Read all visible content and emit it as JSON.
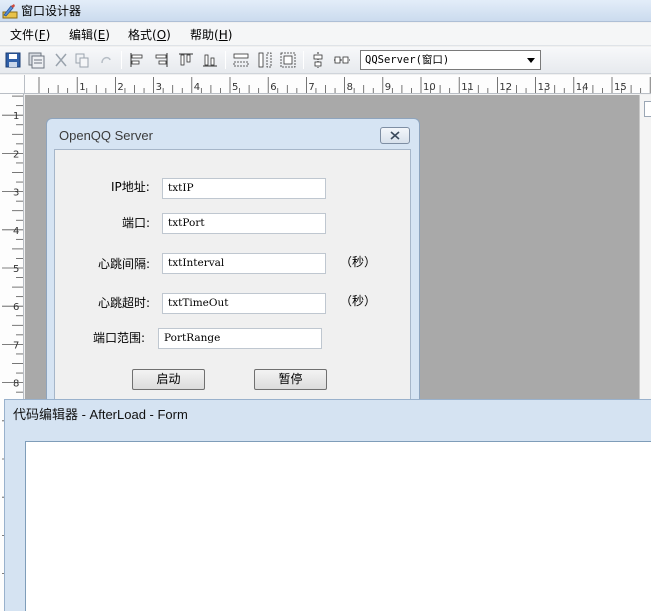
{
  "window": {
    "title": "窗口设计器"
  },
  "menu": {
    "items": [
      {
        "label": "文件(",
        "key": "F",
        "end": ")"
      },
      {
        "label": "编辑(",
        "key": "E",
        "end": ")"
      },
      {
        "label": "格式(",
        "key": "O",
        "end": ")"
      },
      {
        "label": "帮助(",
        "key": "H",
        "end": ")"
      }
    ]
  },
  "toolbar": {
    "selector_value": "QQServer(窗口)"
  },
  "ruler": {
    "h_numbers": [
      "1",
      "2",
      "3",
      "4",
      "5",
      "6",
      "7",
      "8",
      "9",
      "10",
      "11",
      "12",
      "13",
      "14",
      "15"
    ],
    "v_numbers": [
      "1",
      "2",
      "3",
      "4",
      "5",
      "6",
      "7",
      "8"
    ]
  },
  "form": {
    "title": "OpenQQ Server",
    "fields": [
      {
        "label": "IP地址:",
        "value": "txtIP",
        "suffix": ""
      },
      {
        "label": "端口:",
        "value": "txtPort",
        "suffix": ""
      },
      {
        "label": "心跳间隔:",
        "value": "txtInterval",
        "suffix": "（秒）"
      },
      {
        "label": "心跳超时:",
        "value": "txtTimeOut",
        "suffix": "（秒）"
      },
      {
        "label": "端口范围:",
        "value": "PortRange",
        "suffix": ""
      }
    ],
    "start_label": "启动",
    "pause_label": "暂停"
  },
  "editor": {
    "title": "代码编辑器 - AfterLoad - Form"
  },
  "icons": [
    "designer-app-icon",
    "save-icon",
    "save-all-icon",
    "cut-icon",
    "copy-icon",
    "paste-icon",
    "align-left-icon",
    "align-right-icon",
    "align-top-icon",
    "align-bottom-icon",
    "same-width-icon",
    "same-height-icon",
    "same-size-icon",
    "center-vertical-icon",
    "center-horizontal-icon",
    "dropdown-arrow-icon",
    "close-icon"
  ]
}
